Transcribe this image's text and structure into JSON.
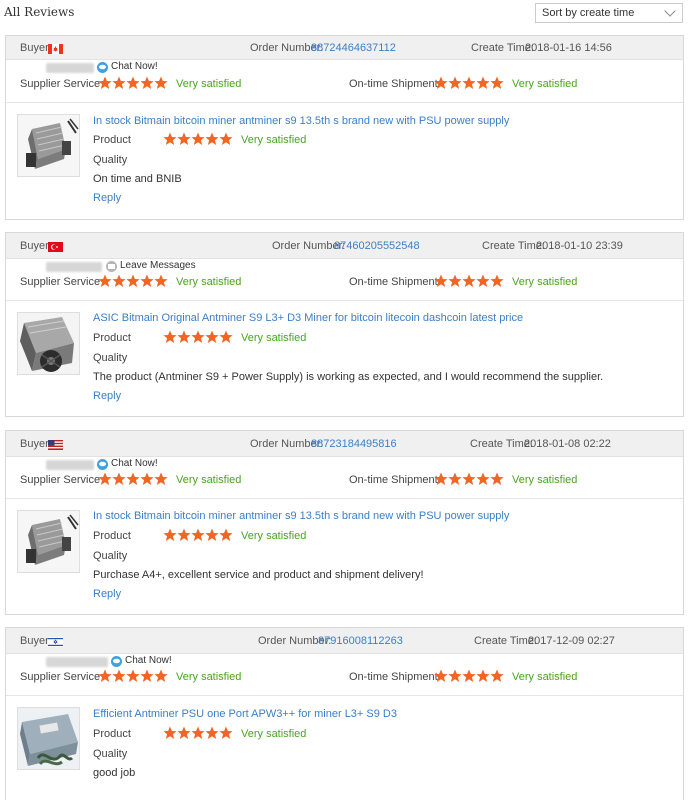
{
  "page": {
    "title": "All Reviews",
    "sort": {
      "selected": "Sort by create time"
    }
  },
  "labels": {
    "buyer": "Buyer:",
    "order_number": "Order Number:",
    "create_time": "Create Time:",
    "supplier_service": "Supplier Service",
    "ontime_shipment": "On-time Shipment",
    "product": "Product",
    "quality": "Quality",
    "reply": "Reply"
  },
  "colors": {
    "star": "#f26522",
    "satisfied": "#49a520",
    "link": "#3a7fc8",
    "header_bg": "#f0f0f0"
  },
  "reviews": [
    {
      "flag": "Canada",
      "order_number": "88724464637112",
      "create_time": "2018-01-16 14:56",
      "contact_icon": "chat-icon",
      "contact_label": "Chat Now!",
      "supplier_service": {
        "stars": 5,
        "text": "Very satisfied"
      },
      "ontime_shipment": {
        "stars": 5,
        "text": "Very satisfied"
      },
      "product_title": "In stock Bitmain bitcoin miner antminer s9 13.5th s brand new with PSU power supply",
      "product_rating": {
        "stars": 5,
        "text": "Very satisfied"
      },
      "comment": "On time and BNIB",
      "thumb": "miner-with-psu"
    },
    {
      "flag": "Turkey",
      "order_number": "87460205552548",
      "create_time": "2018-01-10 23:39",
      "contact_icon": "message-icon",
      "contact_label": "Leave Messages",
      "supplier_service": {
        "stars": 5,
        "text": "Very satisfied"
      },
      "ontime_shipment": {
        "stars": 5,
        "text": "Very satisfied"
      },
      "product_title": "ASIC Bitmain Original Antminer S9 L3+ D3 Miner for bitcoin litecoin dashcoin latest price",
      "product_rating": {
        "stars": 5,
        "text": "Very satisfied"
      },
      "comment": "The product (Antminer S9 + Power Supply) is working as expected, and I would recommend the supplier.",
      "thumb": "miner-fan"
    },
    {
      "flag": "United States",
      "order_number": "88723184495816",
      "create_time": "2018-01-08 02:22",
      "contact_icon": "chat-icon",
      "contact_label": "Chat Now!",
      "supplier_service": {
        "stars": 5,
        "text": "Very satisfied"
      },
      "ontime_shipment": {
        "stars": 5,
        "text": "Very satisfied"
      },
      "product_title": "In stock Bitmain bitcoin miner antminer s9 13.5th s brand new with PSU power supply",
      "product_rating": {
        "stars": 5,
        "text": "Very satisfied"
      },
      "comment": "Purchase A4+, excellent service and product and shipment delivery!",
      "thumb": "miner-with-psu"
    },
    {
      "flag": "Israel",
      "order_number": "87916008112263",
      "create_time": "2017-12-09 02:27",
      "contact_icon": "chat-icon",
      "contact_label": "Chat Now!",
      "supplier_service": {
        "stars": 5,
        "text": "Very satisfied"
      },
      "ontime_shipment": {
        "stars": 5,
        "text": "Very satisfied"
      },
      "product_title": "Efficient Antminer PSU one Port APW3++ for miner L3+ S9 D3",
      "product_rating": {
        "stars": 5,
        "text": "Very satisfied"
      },
      "comment": "good job",
      "thumb": "psu-unit"
    }
  ]
}
